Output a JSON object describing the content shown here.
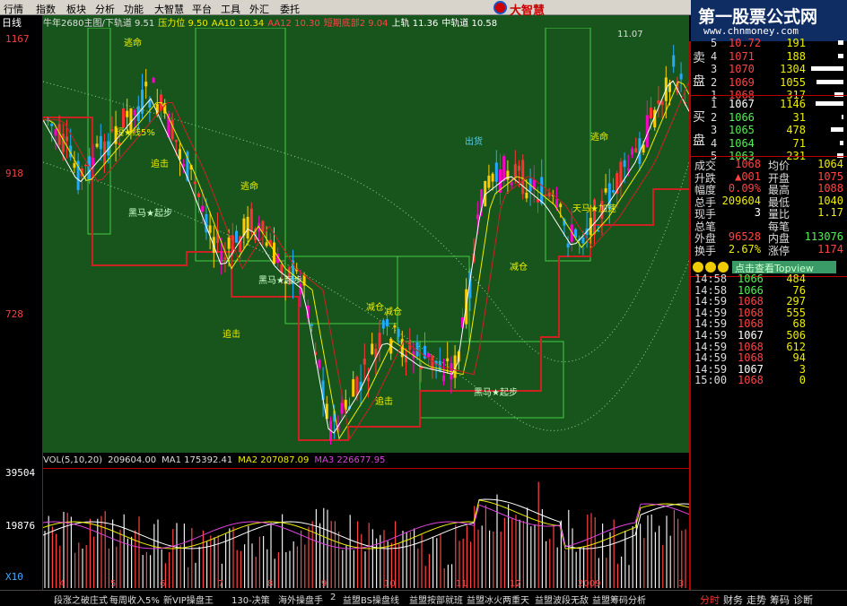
{
  "menu": [
    "行情",
    "指数",
    "板块",
    "分析",
    "功能",
    "大智慧",
    "平台",
    "工具",
    "外汇",
    "委托"
  ],
  "brand": "大智慧",
  "watermark": {
    "main": "第一股票公式网",
    "url": "www.chnmoney.com"
  },
  "period": "日线",
  "indicators": [
    {
      "text": "牛年2680主图/下轨道 9.51",
      "color": "#dddddd"
    },
    {
      "text": "压力位 9.50",
      "color": "#eeee00"
    },
    {
      "text": "AA10 10.34",
      "color": "#eeee00"
    },
    {
      "text": "AA12 10.30",
      "color": "#ff4444"
    },
    {
      "text": "短期底部2 9.04",
      "color": "#ff4444"
    },
    {
      "text": "上轨 11.36",
      "color": "#ffffff"
    },
    {
      "text": "中轨道 10.58",
      "color": "#ffffff"
    }
  ],
  "price_axis": [
    "1167",
    "918",
    "728"
  ],
  "vol_axis": {
    "top": "39504",
    "mid": "19876",
    "mult": "X10"
  },
  "vol_indicator": [
    {
      "text": "VOL(5,10,20)",
      "color": "#dddddd"
    },
    {
      "text": "209604.00",
      "color": "#dddddd"
    },
    {
      "text": "MA1 175392.41",
      "color": "#dddddd"
    },
    {
      "text": "MA2 207087.09",
      "color": "#eeee00"
    },
    {
      "text": "MA3 226677.95",
      "color": "#dd44dd"
    }
  ],
  "chart_labels": [
    "逃命",
    "减仓",
    "追击",
    "黑马★起步",
    "短★线5%",
    "出货",
    "天马★加速",
    "11.07"
  ],
  "bottom_tabs": [
    "段涨之破庄式",
    "每周收入5%",
    "新VIP操盘王",
    "130-决策",
    "海外操盘手",
    "2",
    "益盟BS操盘线",
    "益盟按部就班",
    "益盟冰火两重天",
    "益盟波段无敌",
    "益盟筹码分析"
  ],
  "right_tabs": [
    "分时",
    "财务",
    "走势",
    "筹码",
    "诊断"
  ],
  "order_book": {
    "sell_label": [
      "卖",
      "盘"
    ],
    "buy_label": [
      "买",
      "盘"
    ],
    "sell": [
      {
        "lvl": "5",
        "px": "10.72",
        "vol": "191",
        "bar": 10
      },
      {
        "lvl": "4",
        "px": "1071",
        "vol": "188",
        "bar": 10
      },
      {
        "lvl": "3",
        "px": "1070",
        "vol": "1304",
        "bar": 60
      },
      {
        "lvl": "2",
        "px": "1069",
        "vol": "1055",
        "bar": 50
      },
      {
        "lvl": "1",
        "px": "1068",
        "vol": "317",
        "bar": 16
      }
    ],
    "buy": [
      {
        "lvl": "1",
        "px": "1067",
        "vol": "1146",
        "bar": 52
      },
      {
        "lvl": "2",
        "px": "1066",
        "vol": "31",
        "bar": 4
      },
      {
        "lvl": "3",
        "px": "1065",
        "vol": "478",
        "bar": 24
      },
      {
        "lvl": "4",
        "px": "1064",
        "vol": "71",
        "bar": 6
      },
      {
        "lvl": "5",
        "px": "1063",
        "vol": "231",
        "bar": 12
      }
    ]
  },
  "stats": [
    {
      "k1": "成交",
      "v1": "1068",
      "c1": "up",
      "k2": "均价",
      "v2": "1064",
      "c2": "yl"
    },
    {
      "k1": "升跌",
      "v1": "▲001",
      "c1": "up",
      "k2": "开盘",
      "v2": "1075",
      "c2": "up"
    },
    {
      "k1": "幅度",
      "v1": "0.09%",
      "c1": "up",
      "k2": "最高",
      "v2": "1088",
      "c2": "up"
    },
    {
      "k1": "总手",
      "v1": "209604",
      "c1": "yl",
      "k2": "最低",
      "v2": "1040",
      "c2": "yl"
    },
    {
      "k1": "现手",
      "v1": "3",
      "c1": "wh",
      "k2": "量比",
      "v2": "1.17",
      "c2": "yl"
    },
    {
      "k1": "总笔",
      "v1": "",
      "c1": "wh",
      "k2": "每笔",
      "v2": "",
      "c2": "wh"
    },
    {
      "k1": "外盘",
      "v1": "96528",
      "c1": "up",
      "k2": "内盘",
      "v2": "113076",
      "c2": "dn"
    },
    {
      "k1": "换手",
      "v1": "2.67%",
      "c1": "yl",
      "k2": "涨停",
      "v2": "1174",
      "c2": "up"
    }
  ],
  "promo": "点击查看Topview",
  "ticks": [
    {
      "t": "14:58",
      "p": "1066",
      "c": "dn",
      "v": "484"
    },
    {
      "t": "14:58",
      "p": "1066",
      "c": "dn",
      "v": "76"
    },
    {
      "t": "14:59",
      "p": "1068",
      "c": "up",
      "v": "297"
    },
    {
      "t": "14:59",
      "p": "1068",
      "c": "up",
      "v": "555"
    },
    {
      "t": "14:59",
      "p": "1068",
      "c": "up",
      "v": "68"
    },
    {
      "t": "14:59",
      "p": "1067",
      "c": "wh",
      "v": "506"
    },
    {
      "t": "14:59",
      "p": "1068",
      "c": "up",
      "v": "612"
    },
    {
      "t": "14:59",
      "p": "1068",
      "c": "up",
      "v": "94"
    },
    {
      "t": "14:59",
      "p": "1067",
      "c": "wh",
      "v": "3"
    },
    {
      "t": "15:00",
      "p": "1068",
      "c": "up",
      "v": "0"
    }
  ],
  "x_axis_labels": [
    "4",
    "5",
    "6",
    "7",
    "8",
    "9",
    "10",
    "11",
    "12",
    "2009",
    "3"
  ],
  "colors": {
    "panel_green": "#18551d",
    "up": "#ff4444",
    "down": "#55ee55",
    "accent_red": "#bb0000"
  }
}
